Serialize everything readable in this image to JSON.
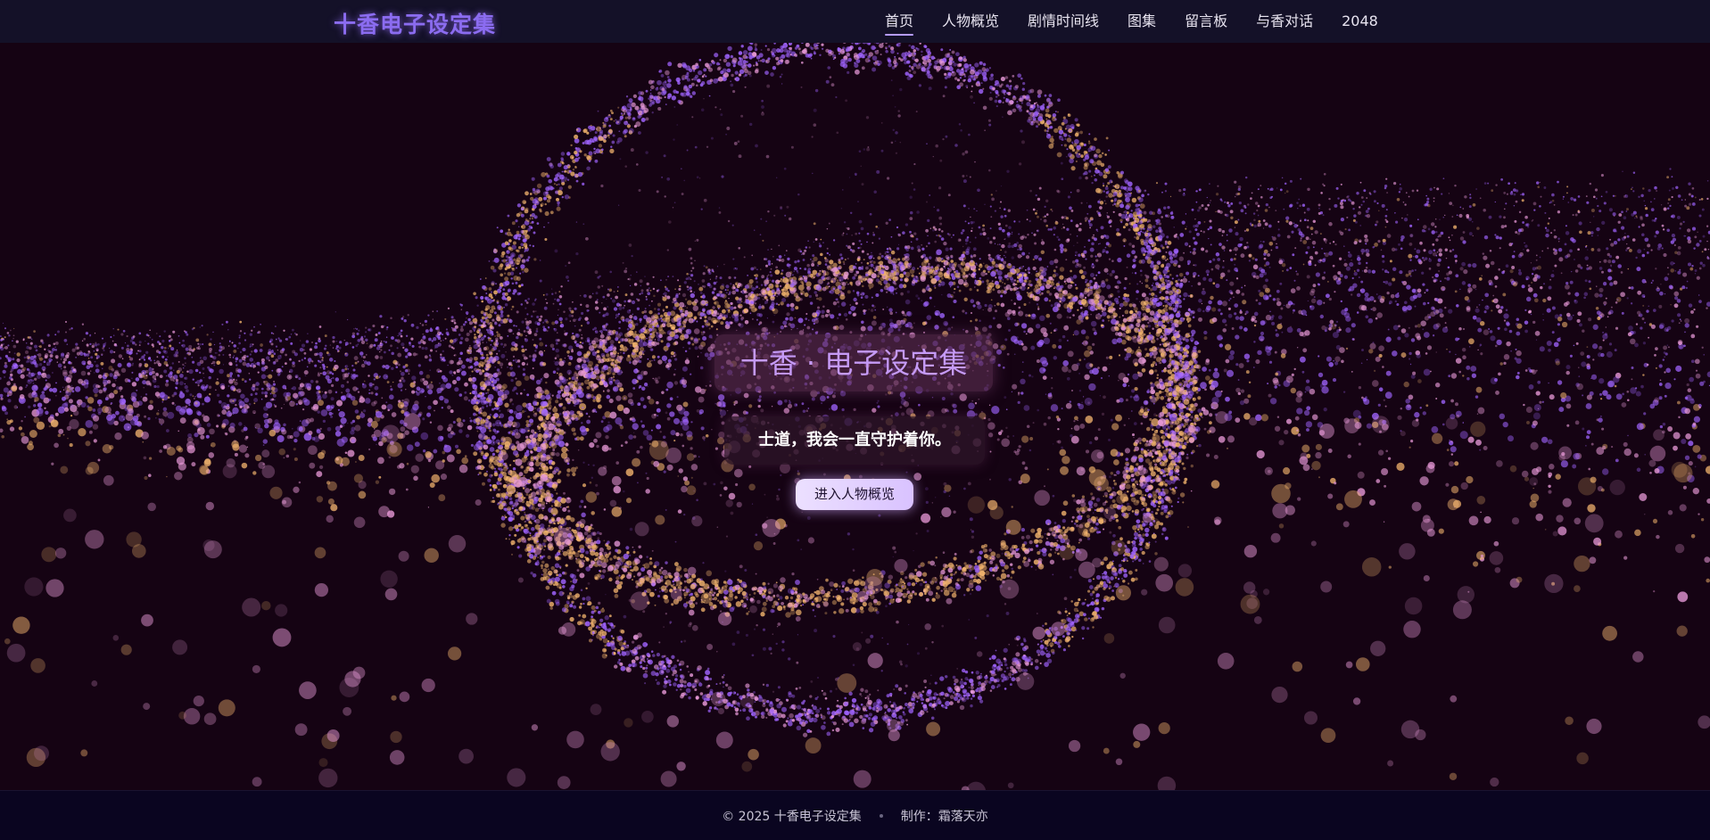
{
  "navbar": {
    "brand": "十香电子设定集",
    "items": [
      {
        "label": "首页",
        "active": true
      },
      {
        "label": "人物概览",
        "active": false
      },
      {
        "label": "剧情时间线",
        "active": false
      },
      {
        "label": "图集",
        "active": false
      },
      {
        "label": "留言板",
        "active": false
      },
      {
        "label": "与香对话",
        "active": false
      },
      {
        "label": "2048",
        "active": false
      }
    ]
  },
  "hero": {
    "title": "十香 · 电子设定集",
    "subtitle": "士道，我会一直守护着你。",
    "button_label": "进入人物概览"
  },
  "footer": {
    "copyright": "© 2025 十香电子设定集",
    "credit": "制作：霜落天亦"
  },
  "colors": {
    "background": "#150313",
    "navbar": "#141128",
    "footer": "#0a0520",
    "brand": "#8b6cf0",
    "particle_purple": "#a064ff",
    "particle_pink": "#e89ad8",
    "particle_gold": "#f2b46e"
  }
}
